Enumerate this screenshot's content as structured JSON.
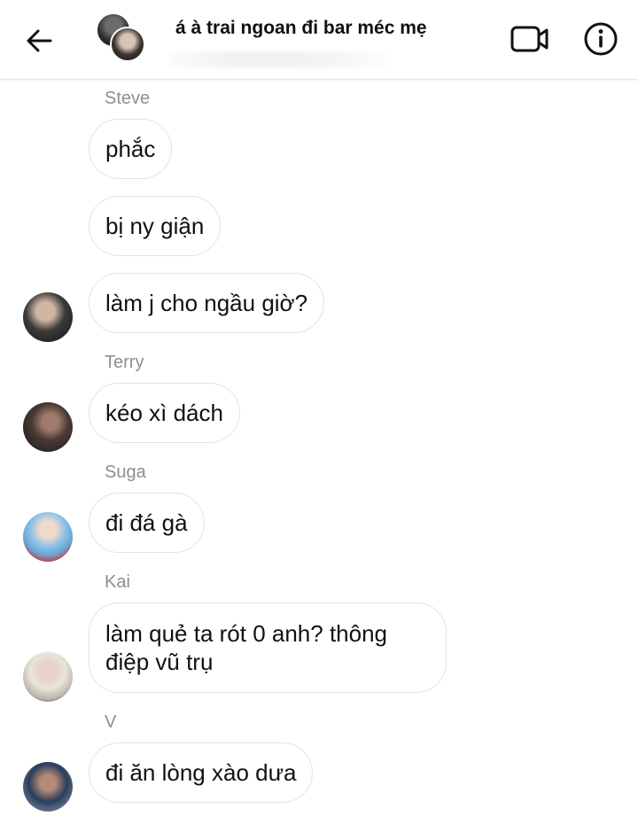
{
  "header": {
    "back_icon": "arrow-left-icon",
    "title": "á à trai ngoan đi bar méc mẹ",
    "video_icon": "video-camera-icon",
    "info_icon": "info-circle-icon"
  },
  "messages": [
    {
      "sender": "Steve",
      "text": "phắc"
    },
    {
      "sender": "",
      "text": "bị ny giận"
    },
    {
      "sender": "",
      "text": "làm j cho ngầu giờ?"
    },
    {
      "sender": "Terry",
      "text": "kéo xì dách"
    },
    {
      "sender": "Suga",
      "text": "đi đá gà"
    },
    {
      "sender": "Kai",
      "text": "làm quẻ ta rót 0 anh? thông điệp vũ trụ"
    },
    {
      "sender": "V",
      "text": "đi ăn lòng xào dưa"
    }
  ],
  "colors": {
    "bubble_border": "#e3e3e3",
    "sender_label": "#8e8e8e",
    "background": "#ffffff"
  }
}
